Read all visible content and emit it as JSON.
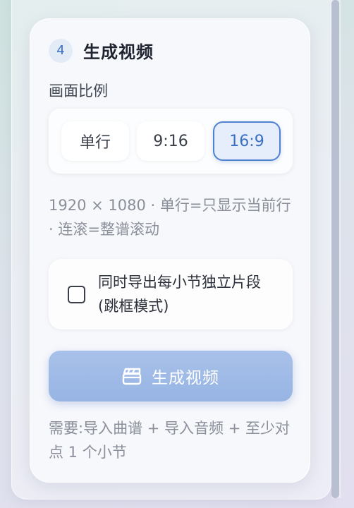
{
  "panel": {
    "step_number": "4",
    "title": "生成视频"
  },
  "aspect": {
    "label": "画面比例",
    "options": [
      "单行",
      "9:16",
      "16:9"
    ],
    "selected": "16:9"
  },
  "hint": "1920 × 1080 · 单行=只显示当前行 · 连滚=整谱滚动",
  "segment_export": {
    "checked": false,
    "label": "同时导出每小节独立片段(跳框模式)"
  },
  "generate": {
    "label": "生成视频",
    "icon": "clapperboard-icon"
  },
  "requirement": "需要:导入曲谱 + 导入音频 + 至少对点 1 个小节",
  "colors": {
    "accent": "#4f82d3",
    "button": "#a8c1ea"
  }
}
